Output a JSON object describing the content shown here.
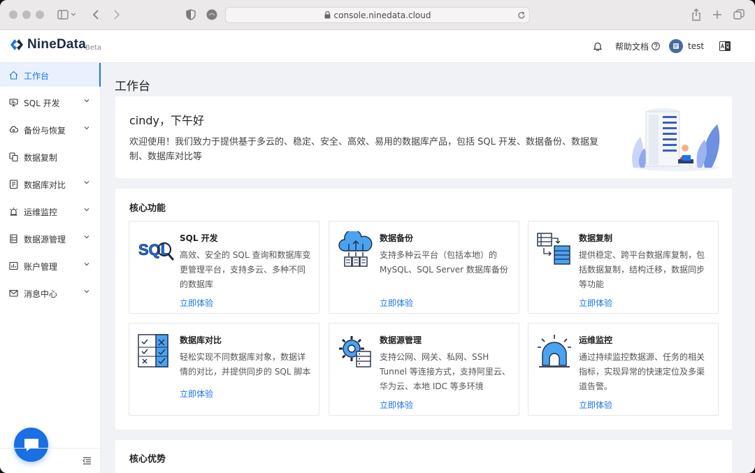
{
  "browser": {
    "url": "console.ninedata.cloud"
  },
  "header": {
    "brand": "NineData",
    "beta": "Beta",
    "help_label": "帮助文档",
    "user_name": "test"
  },
  "sidebar": {
    "items": [
      {
        "label": "工作台",
        "icon": "home-icon",
        "active": true,
        "expandable": false
      },
      {
        "label": "SQL 开发",
        "icon": "monitor-icon",
        "active": false,
        "expandable": true
      },
      {
        "label": "备份与恢复",
        "icon": "cloud-icon",
        "active": false,
        "expandable": true
      },
      {
        "label": "数据复制",
        "icon": "copy-icon",
        "active": false,
        "expandable": false
      },
      {
        "label": "数据库对比",
        "icon": "compare-icon",
        "active": false,
        "expandable": true
      },
      {
        "label": "运维监控",
        "icon": "alarm-icon",
        "active": false,
        "expandable": true
      },
      {
        "label": "数据源管理",
        "icon": "datasource-icon",
        "active": false,
        "expandable": true
      },
      {
        "label": "账户管理",
        "icon": "account-icon",
        "active": false,
        "expandable": true
      },
      {
        "label": "消息中心",
        "icon": "mail-icon",
        "active": false,
        "expandable": true
      }
    ]
  },
  "main": {
    "page_title": "工作台",
    "greeting": "cindy，下午好",
    "welcome_text": "欢迎使用！我们致力于提供基于多云的、稳定、安全、高效、易用的数据库产品，包括 SQL 开发、数据备份、数据复制、数据库对比等",
    "core_features_title": "核心功能",
    "core_advantages_title": "核心优势",
    "features": [
      {
        "title": "SQL 开发",
        "desc": "高效、安全的 SQL 查询和数据库变更管理平台，支持多云、多种不同的数据库",
        "link": "立即体验",
        "icon": "sql-icon"
      },
      {
        "title": "数据备份",
        "desc": "支持多种云平台（包括本地）的 MySQL、SQL Server 数据库备份",
        "link": "立即体验",
        "icon": "cloud-backup-icon"
      },
      {
        "title": "数据复制",
        "desc": "提供稳定、跨平台数据库复制，包括数据复制，结构迁移，数据同步等功能",
        "link": "立即体验",
        "icon": "data-replication-icon"
      },
      {
        "title": "数据库对比",
        "desc": "轻松实现不同数据库对象，数据详情的对比，并提供同步的 SQL 脚本",
        "link": "立即体验",
        "icon": "checklist-icon"
      },
      {
        "title": "数据源管理",
        "desc": "支持公网、网关、私网、SSH Tunnel 等连接方式，支持阿里云、华为云、本地 IDC 等多环境",
        "link": "立即体验",
        "icon": "gear-server-icon"
      },
      {
        "title": "运维监控",
        "desc": "通过持续监控数据源、任务的相关指标，实现异常的快速定位及多渠道告警。",
        "link": "立即体验",
        "icon": "alarm-light-icon"
      }
    ]
  },
  "colors": {
    "accent": "#1a73e8",
    "brand": "#1f2a44"
  }
}
